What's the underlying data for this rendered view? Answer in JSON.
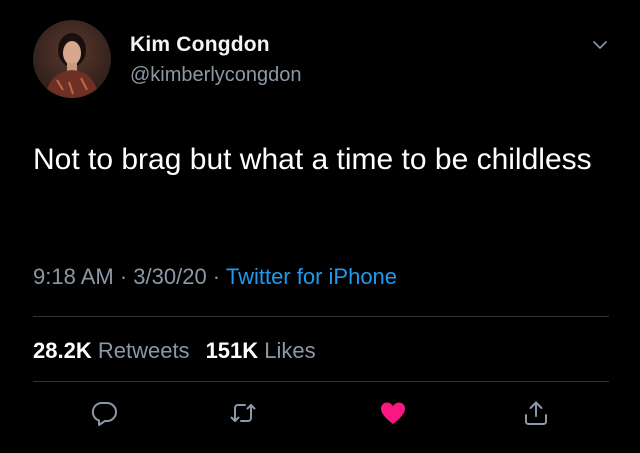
{
  "user": {
    "display_name": "Kim Congdon",
    "handle": "@kimberlycongdon"
  },
  "tweet": {
    "text": "Not to brag but what a time to be childless",
    "time": "9:18 AM",
    "separator": " · ",
    "date": "3/30/20",
    "source": "Twitter for iPhone"
  },
  "stats": {
    "retweets_count": "28.2K",
    "retweets_label": "Retweets",
    "likes_count": "151K",
    "likes_label": "Likes"
  },
  "actions": {
    "icons": [
      "reply-icon",
      "retweet-icon",
      "like-icon",
      "share-icon"
    ],
    "liked": true
  },
  "colors": {
    "background": "#000000",
    "secondary_text": "#8b98a5",
    "link": "#1d9bf0",
    "like": "#f91880",
    "divider": "#2f3336"
  }
}
